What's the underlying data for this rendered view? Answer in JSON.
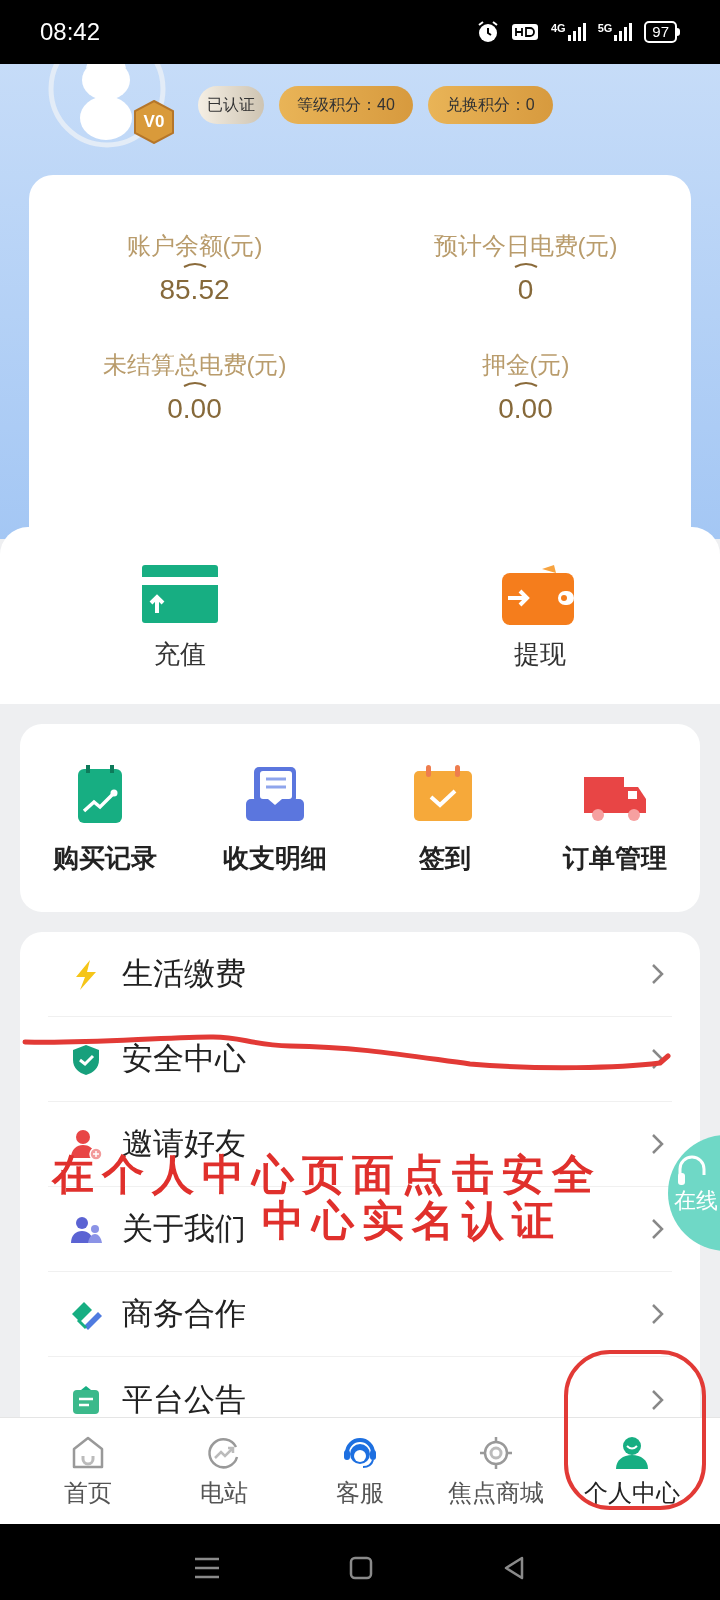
{
  "status_bar": {
    "time": "08:42",
    "network_1": "4G",
    "network_2": "5G",
    "battery": "97"
  },
  "profile": {
    "level_badge": "V0",
    "badges": [
      {
        "kind": "verified",
        "label": "已认证"
      },
      {
        "kind": "points",
        "label": "等级积分：40"
      },
      {
        "kind": "points",
        "label": "兑换积分：0"
      }
    ]
  },
  "stats": [
    {
      "label": "账户余额(元)",
      "value": "85.52"
    },
    {
      "label": "预计今日电费(元)",
      "value": "0"
    },
    {
      "label": "未结算总电费(元)",
      "value": "0.00"
    },
    {
      "label": "押金(元)",
      "value": "0.00"
    }
  ],
  "actions": [
    {
      "kind": "recharge",
      "label": "充值"
    },
    {
      "kind": "withdraw",
      "label": "提现"
    }
  ],
  "shortcuts": [
    {
      "kind": "records",
      "label": "购买记录"
    },
    {
      "kind": "details",
      "label": "收支明细"
    },
    {
      "kind": "checkin",
      "label": "签到"
    },
    {
      "kind": "orders",
      "label": "订单管理"
    }
  ],
  "menu": [
    {
      "kind": "bolt",
      "label": "生活缴费"
    },
    {
      "kind": "shield",
      "label": "安全中心"
    },
    {
      "kind": "invite",
      "label": "邀请好友"
    },
    {
      "kind": "about",
      "label": "关于我们"
    },
    {
      "kind": "business",
      "label": "商务合作"
    },
    {
      "kind": "notice",
      "label": "平台公告"
    }
  ],
  "floating_button": {
    "label": "在线"
  },
  "tabs": [
    {
      "kind": "home",
      "label": "首页",
      "selected": false
    },
    {
      "kind": "station",
      "label": "电站",
      "selected": false
    },
    {
      "kind": "service",
      "label": "客服",
      "selected": false
    },
    {
      "kind": "mall",
      "label": "焦点商城",
      "selected": false
    },
    {
      "kind": "profile",
      "label": "个人中心",
      "selected": true
    }
  ],
  "annotation": {
    "lines": [
      "在个人中心页面点击安全",
      "中心实名认证"
    ]
  }
}
